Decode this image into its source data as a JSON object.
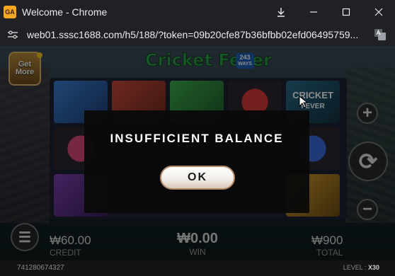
{
  "window": {
    "title": "Welcome - Chrome",
    "app_icon_text": "GA"
  },
  "address_bar": {
    "url": "web01.sssc1688.com/h5/188/?token=09b20cfe87b36bfbb02efd06495759..."
  },
  "game": {
    "logo_text": "Cricket Fever",
    "logo_badge_top": "243",
    "logo_badge_bottom": "WAYS",
    "get_more_line1": "Get",
    "get_more_line2": "More",
    "credit_value": "₩60.00",
    "credit_label": "CREDIT",
    "win_value": "₩0.00",
    "win_label": "WIN",
    "total_value": "₩900",
    "total_label": "TOTAL",
    "round_id": "741280674327",
    "level_label": "LEVEL :",
    "level_value": "X30",
    "symbol_cricket_fever_line1": "CRICKET",
    "symbol_cricket_fever_line2": "FEVER"
  },
  "modal": {
    "title": "INSUFFICIENT BALANCE",
    "ok_label": "OK"
  },
  "colors": {
    "accent_green": "#2f9e4a",
    "ok_border": "#b38a6a",
    "modal_bg": "#0a0a0a"
  }
}
